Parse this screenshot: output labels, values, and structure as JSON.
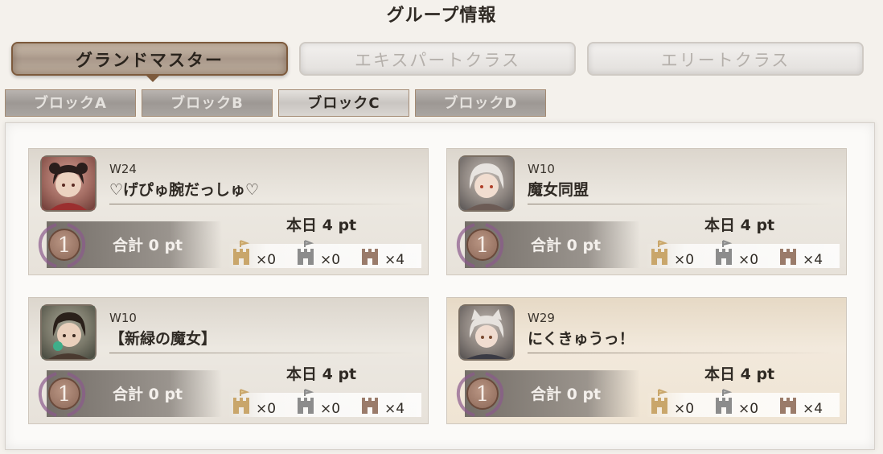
{
  "header": {
    "title": "グループ情報"
  },
  "class_tabs": [
    {
      "label": "グランドマスター",
      "active": true
    },
    {
      "label": "エキスパートクラス",
      "active": false
    },
    {
      "label": "エリートクラス",
      "active": false
    }
  ],
  "block_tabs": [
    {
      "label": "ブロックA",
      "active": false
    },
    {
      "label": "ブロックB",
      "active": false
    },
    {
      "label": "ブロックC",
      "active": true
    },
    {
      "label": "ブロックD",
      "active": false
    }
  ],
  "groups": [
    {
      "world": "W24",
      "name": "♡げぴゅ腕だっしゅ♡",
      "rank": "1",
      "total": "合計 0 pt",
      "today": "本日 4 pt",
      "gold": "×0",
      "silver": "×0",
      "bronze": "×4",
      "avatar": "avatar-dark-hair-girl"
    },
    {
      "world": "W10",
      "name": "魔女同盟",
      "rank": "1",
      "total": "合計 0 pt",
      "today": "本日 4 pt",
      "gold": "×0",
      "silver": "×0",
      "bronze": "×4",
      "avatar": "avatar-white-hair-girl"
    },
    {
      "world": "W10",
      "name": "【新緑の魔女】",
      "rank": "1",
      "total": "合計 0 pt",
      "today": "本日 4 pt",
      "gold": "×0",
      "silver": "×0",
      "bronze": "×4",
      "avatar": "avatar-green-gem-girl"
    },
    {
      "world": "W29",
      "name": "にくきゅうっ！",
      "rank": "1",
      "total": "合計 0 pt",
      "today": "本日 4 pt",
      "gold": "×0",
      "silver": "×0",
      "bronze": "×4",
      "avatar": "avatar-cat-ear-girl"
    }
  ],
  "colors": {
    "gold_castle": "#c9a66b",
    "silver_castle": "#8c8c8c",
    "bronze_castle": "#9a7b6a",
    "accent": "#7d5a3c"
  }
}
